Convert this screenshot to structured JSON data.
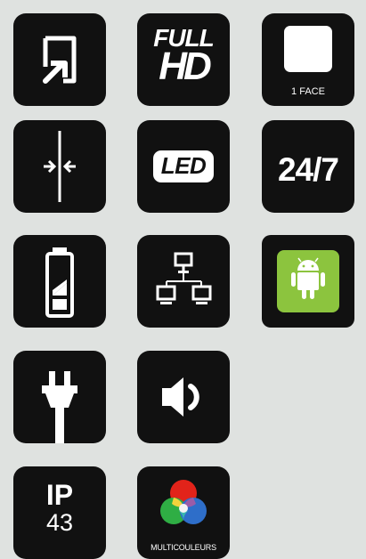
{
  "tiles": {
    "touch": {
      "icon": "touch-screen-icon"
    },
    "fullhd": {
      "line1": "FULL",
      "line2": "HD",
      "icon": "full-hd-icon"
    },
    "oneface": {
      "label": "1 FACE",
      "icon": "single-face-icon"
    },
    "thin": {
      "icon": "thin-profile-icon"
    },
    "led": {
      "label": "LED",
      "icon": "led-icon"
    },
    "hours": {
      "label": "24/7",
      "icon": "24-7-icon"
    },
    "battery": {
      "icon": "battery-icon"
    },
    "network": {
      "icon": "network-icon"
    },
    "android": {
      "icon": "android-icon",
      "color": "#8cc43e"
    },
    "power": {
      "icon": "power-plug-icon"
    },
    "sound": {
      "icon": "speaker-icon"
    },
    "ip": {
      "line1": "IP",
      "line2": "43",
      "icon": "ip-rating-icon"
    },
    "multicolor": {
      "label": "MULTICOULEURS",
      "icon": "rgb-color-icon"
    }
  }
}
